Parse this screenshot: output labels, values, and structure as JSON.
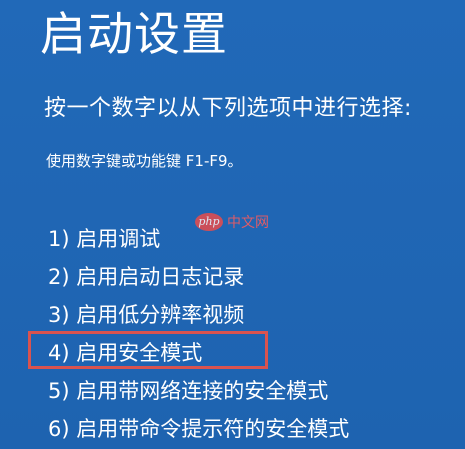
{
  "screen": {
    "title": "启动设置",
    "subtitle": "按一个数字以从下列选项中进行选择:",
    "hint": "使用数字键或功能键 F1-F9。"
  },
  "options": [
    {
      "label": "1) 启用调试"
    },
    {
      "label": "2) 启用启动日志记录"
    },
    {
      "label": "3) 启用低分辨率视频"
    },
    {
      "label": "4) 启用安全模式"
    },
    {
      "label": "5) 启用带网络连接的安全模式"
    },
    {
      "label": "6) 启用带命令提示符的安全模式"
    }
  ],
  "highlighted_option": 4,
  "watermark": {
    "logo": "php",
    "text": "中文网"
  },
  "colors": {
    "background": "#1f66b6",
    "text": "#ffffff",
    "highlight": "#d9534f"
  }
}
